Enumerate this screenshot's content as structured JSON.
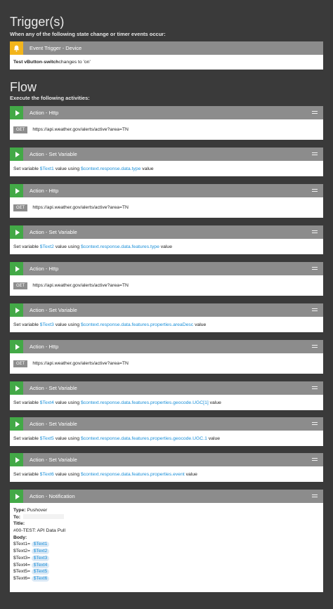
{
  "triggers": {
    "heading": "Trigger(s)",
    "subheading": "When any of the following state change or timer events occur:",
    "card": {
      "title": "Event Trigger - Device",
      "device": "Test vButton",
      "sep": " - ",
      "attribute": "switch",
      "rest": " changes to 'on'"
    }
  },
  "flow": {
    "heading": "Flow",
    "subheading": "Execute the following activities:"
  },
  "actions": [
    {
      "title": "Action - Http",
      "method": "GET",
      "url": "https://api.weather.gov/alerts/active?area=TN"
    },
    {
      "title": "Action - Set Variable",
      "prefix": "Set variable ",
      "var": "$Text1",
      "mid": " value using ",
      "expr": "$context.response.data.type",
      "suffix": " value"
    },
    {
      "title": "Action - Http",
      "method": "GET",
      "url": "https://api.weather.gov/alerts/active?area=TN"
    },
    {
      "title": "Action - Set Variable",
      "prefix": "Set variable ",
      "var": "$Text2",
      "mid": " value using ",
      "expr": "$context.response.data.features.type",
      "suffix": " value"
    },
    {
      "title": "Action - Http",
      "method": "GET",
      "url": "https://api.weather.gov/alerts/active?area=TN"
    },
    {
      "title": "Action - Set Variable",
      "prefix": "Set variable ",
      "var": "$Text3",
      "mid": " value using ",
      "expr": "$context.response.data.features.properties.areaDesc",
      "suffix": " value"
    },
    {
      "title": "Action - Http",
      "method": "GET",
      "url": "https://api.weather.gov/alerts/active?area=TN"
    },
    {
      "title": "Action - Set Variable",
      "prefix": "Set variable ",
      "var": "$Text4",
      "mid": " value using ",
      "expr": "$context.response.data.features.properties.geocode.UGC[1]",
      "suffix": " value"
    },
    {
      "title": "Action - Set Variable",
      "prefix": "Set variable ",
      "var": "$Text5",
      "mid": " value using ",
      "expr": "$context.response.data.features.properties.geocode.UGC.1",
      "suffix": " value"
    },
    {
      "title": "Action - Set Variable",
      "prefix": "Set variable ",
      "var": "$Text6",
      "mid": " value using ",
      "expr": "$context.response.data.features.properties.event",
      "suffix": " value"
    }
  ],
  "notification": {
    "title": "Action - Notification",
    "type_label": "Type:",
    "type_value": " Pushover",
    "to_label": "To:",
    "title_label": "Title:",
    "title_value": "#00-TEST: API Data Pull",
    "body_label": "Body:",
    "body_lines": [
      {
        "label": "$Text1= ",
        "pill": "$Text1"
      },
      {
        "label": "$Text2= ",
        "pill": "$Text2"
      },
      {
        "label": "$Text3= ",
        "pill": "$Text3"
      },
      {
        "label": "$Text4= ",
        "pill": "$Text4"
      },
      {
        "label": "$Text5= ",
        "pill": "$Text5"
      },
      {
        "label": "$Text6= ",
        "pill": "$Text6"
      }
    ]
  }
}
